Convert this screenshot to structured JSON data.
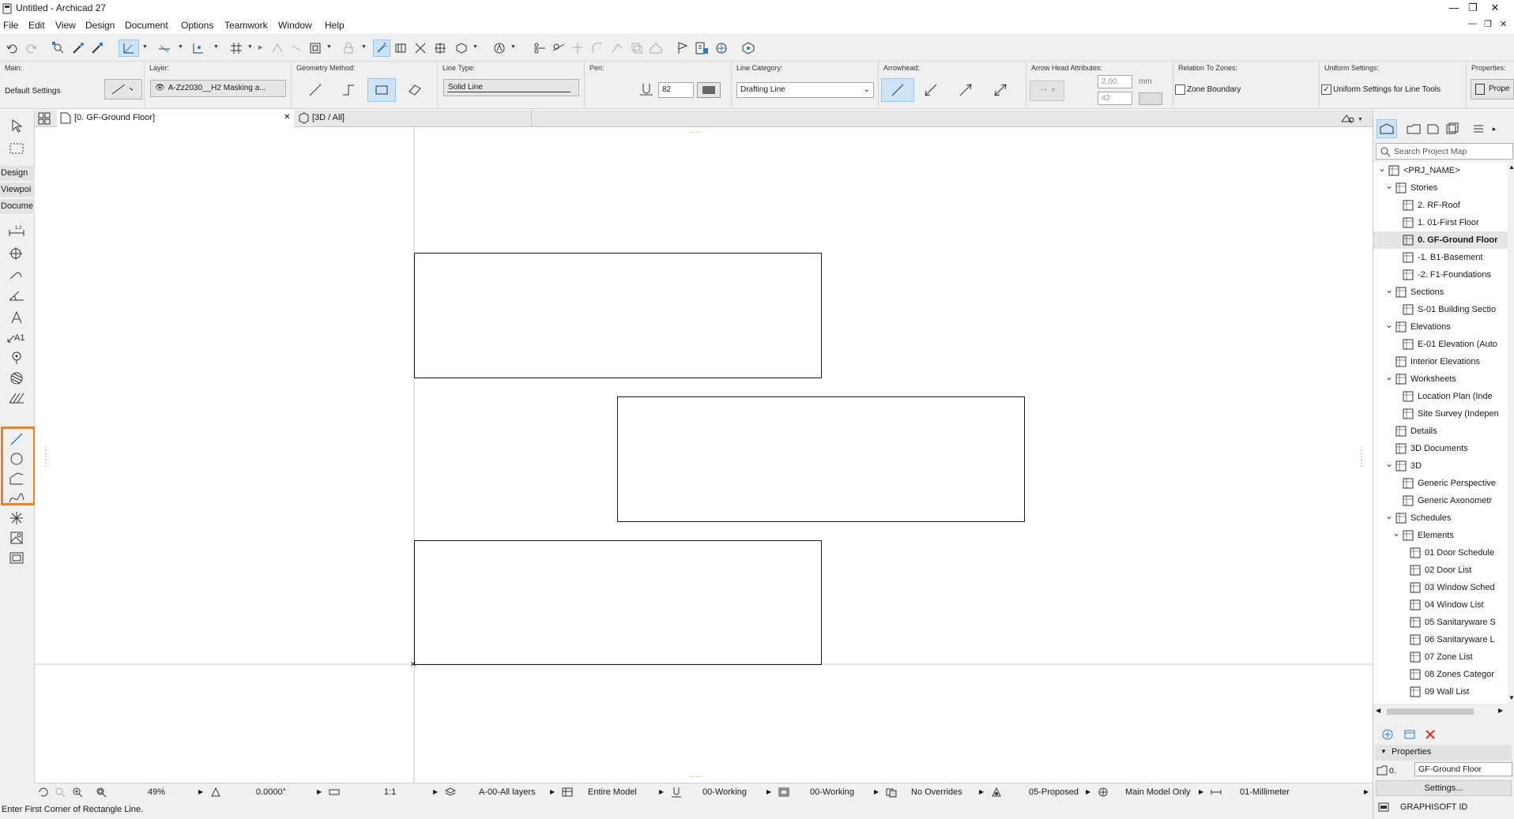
{
  "window": {
    "title": "Untitled - Archicad 27",
    "controls": [
      "—",
      "❐",
      "✕"
    ],
    "mdi_controls": [
      "—",
      "❐",
      "✕"
    ]
  },
  "menu": [
    "File",
    "Edit",
    "View",
    "Design",
    "Document",
    "Options",
    "Teamwork",
    "Window",
    "Help"
  ],
  "infobox": {
    "main": {
      "label": "Main:",
      "value": "Default Settings"
    },
    "layer": {
      "label": "Layer:",
      "value": "A-Zz2030__H2 Masking a..."
    },
    "geometry": {
      "label": "Geometry Method:"
    },
    "line_type": {
      "label": "Line Type:",
      "value": "Solid Line"
    },
    "pen": {
      "label": "Pen:",
      "value": "82"
    },
    "line_category": {
      "label": "Line Category:",
      "value": "Drafting Line"
    },
    "arrowhead": {
      "label": "Arrowhead:"
    },
    "arrow_attrs": {
      "label": "Arrow Head Attributes:",
      "size": "2.00",
      "unit": "mm",
      "pen": "42"
    },
    "relation": {
      "label": "Relation To Zones:",
      "checkbox": "Zone Boundary"
    },
    "uniform": {
      "label": "Uniform Settings:",
      "checkbox": "Uniform Settings for Line Tools"
    },
    "properties": {
      "label": "Properties:",
      "button": "Prope"
    }
  },
  "tabs": [
    {
      "label": "[0. GF-Ground Floor]",
      "close": "✕"
    },
    {
      "label": "[3D / All]"
    }
  ],
  "toolbox": {
    "sections": [
      "Design",
      "Viewpoi",
      "Docume"
    ]
  },
  "canvas": {
    "marker_top": "----",
    "marker_bottom": "----",
    "origin": "×"
  },
  "navigator": {
    "search_placeholder": "Search Project Map",
    "tree": [
      {
        "label": "<PRJ_NAME>",
        "twist": "v",
        "icon": "project-icon",
        "depth": 0
      },
      {
        "label": "Stories",
        "twist": "v",
        "icon": "stories-icon",
        "depth": 1
      },
      {
        "label": "2. RF-Roof",
        "icon": "story-icon",
        "depth": 2
      },
      {
        "label": "1. 01-First Floor",
        "icon": "story-icon",
        "depth": 2
      },
      {
        "label": "0. GF-Ground Floor",
        "icon": "story-icon",
        "depth": 2,
        "selected": true
      },
      {
        "label": "-1. B1-Basement",
        "icon": "story-icon",
        "depth": 2
      },
      {
        "label": "-2. F1-Foundations",
        "icon": "story-icon",
        "depth": 2
      },
      {
        "label": "Sections",
        "twist": "v",
        "icon": "folder-icon",
        "depth": 1
      },
      {
        "label": "S-01 Building Sectio",
        "icon": "section-icon",
        "depth": 2
      },
      {
        "label": "Elevations",
        "twist": "v",
        "icon": "folder-icon",
        "depth": 1
      },
      {
        "label": "E-01 Elevation (Auto",
        "icon": "elevation-icon",
        "depth": 2
      },
      {
        "label": "Interior Elevations",
        "icon": "interior-elevation-icon",
        "depth": 1
      },
      {
        "label": "Worksheets",
        "twist": "v",
        "icon": "worksheet-icon",
        "depth": 1
      },
      {
        "label": "Location Plan (Inde",
        "icon": "worksheet-icon",
        "depth": 2
      },
      {
        "label": "Site Survey (Indepen",
        "icon": "worksheet-icon",
        "depth": 2
      },
      {
        "label": "Details",
        "icon": "detail-icon",
        "depth": 1
      },
      {
        "label": "3D Documents",
        "icon": "3d-document-icon",
        "depth": 1
      },
      {
        "label": "3D",
        "twist": "v",
        "icon": "3d-icon",
        "depth": 1
      },
      {
        "label": "Generic Perspective",
        "icon": "perspective-icon",
        "depth": 2
      },
      {
        "label": "Generic Axonometr",
        "icon": "axonometry-icon",
        "depth": 2
      },
      {
        "label": "Schedules",
        "twist": "v",
        "icon": "schedule-icon",
        "depth": 1
      },
      {
        "label": "Elements",
        "twist": "v",
        "icon": "elements-icon",
        "depth": 2
      },
      {
        "label": "01 Door Schedule",
        "icon": "table-icon",
        "depth": 3
      },
      {
        "label": "02 Door List",
        "icon": "table-icon",
        "depth": 3
      },
      {
        "label": "03 Window Sched",
        "icon": "table-icon",
        "depth": 3
      },
      {
        "label": "04 Window List",
        "icon": "table-icon",
        "depth": 3
      },
      {
        "label": "05 Sanitaryware S",
        "icon": "table-icon",
        "depth": 3
      },
      {
        "label": "06 Sanitaryware L",
        "icon": "table-icon",
        "depth": 3
      },
      {
        "label": "07 Zone List",
        "icon": "table-icon",
        "depth": 3
      },
      {
        "label": "08 Zones Categor",
        "icon": "table-icon",
        "depth": 3
      },
      {
        "label": "09 Wall List",
        "icon": "table-icon",
        "depth": 3
      }
    ],
    "properties_header": "Properties",
    "prop_id": "0.",
    "prop_name": "GF-Ground Floor",
    "settings_button": "Settings...",
    "brand": "GRAPHISOFT ID"
  },
  "statusbar": {
    "zoom": "49%",
    "angle": "0.0000°",
    "scale": "1:1",
    "layer_combo": "A-00-All layers",
    "model_view": "Entire Model",
    "pen_set": "00-Working",
    "mvo": "00-Working",
    "overrides": "No Overrides",
    "renovation": "05-Proposed",
    "structure": "Main Model Only",
    "dimension": "01-Millimeter"
  },
  "prompt": "Enter First Corner of Rectangle Line.",
  "colors": {
    "highlight": "#f28020",
    "selection": "#cde4f7",
    "accent_blue": "#2a7ccf",
    "delete_red": "#e03020"
  }
}
